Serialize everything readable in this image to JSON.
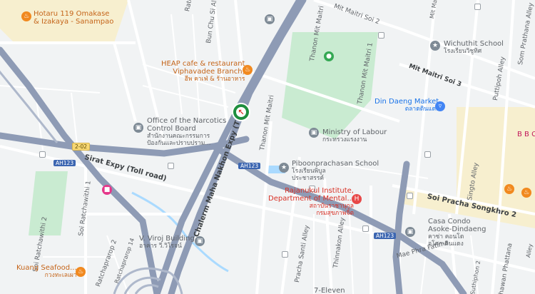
{
  "colors": {
    "background": "#f1f3f4",
    "road": "#ffffff",
    "expressway": "#8e9bb5",
    "park": "#c9ebd1",
    "water": "#aadaff",
    "highlight": "#f7efcf"
  },
  "roads": {
    "mit_maitri_soi_2": "Mit Maitri Soi 2",
    "mit_maitri_soi_3": "Mit Maitri Soi 3",
    "ratchawithi_1": "Ratchawithi",
    "bun_chu_si": "Bun Chu Si Alley",
    "thanon_mit_maitri_a": "Thanon Mit Maitri",
    "thanon_mit_maitri_b": "Thanon Mit Maitri",
    "thanon_mit_maitri_c": "Thanon Mit Maitri",
    "sirat_expy": "Sirat Expy (Toll road)",
    "chalerm_expy": "Chalerm Maha Nakhon Expy (T",
    "soi_ratchawithi_1": "Soi Ratchawithi 1",
    "soi_pracha_songkhro_2": "Soi Pracha Songkhro 2",
    "pracha_santi": "Pracha Santi Alley",
    "thinnakon": "Thinnakon Alley",
    "singto": "Singto Alley",
    "puttipoh": "Puttipoh Alley",
    "som_prathana": "Som Prathana Alley",
    "ratchaprarop_2": "Ratchaprarop 2",
    "ratchaprarop_14": "Ratchaprarop 14",
    "suthiphon_2": "Suthiphon 2",
    "mae_phra_fatima": "Mae Phra Fatima",
    "thawan_phattana": "hawan Phattana",
    "mit_maitri_soi_1": "Mit Maitri Soi 1",
    "alley_right": "Alley",
    "soi_ratchawithi_2": "Soi Ratchawithi 2",
    "thanon_mit_maitri_1": "Thanon Mit Maitri 1"
  },
  "shields": {
    "ah123_a": "AH123",
    "ah123_b": "AH123",
    "ah123_c": "AH123",
    "route_2": "2-02"
  },
  "places": {
    "hotaru": {
      "name": "Hotaru 119 Omakase",
      "line2": "& Izakaya - Sanampao",
      "icon": "restaurant-icon"
    },
    "heap": {
      "name": "HEAP cafe & restaurant",
      "line2": "Viphavadee Branch)",
      "thai": "ฮีพ คาเฟ่ & ร้านอาหาร"
    },
    "narcotics": {
      "name": "Office of the Narcotics",
      "line2": "Control Board",
      "thai1": "สำนักงานคณะกรรมการ",
      "thai2": "ป้องกันและปราบปราม..."
    },
    "ministry": {
      "name": "Ministry of Labour",
      "thai": "กระทรวงแรงงาน"
    },
    "piboon": {
      "name": "Piboonprachasan School",
      "thai1": "โรงเรียนพิบูล",
      "thai2": "ประชาสรรค์"
    },
    "rajanukul": {
      "name": "Rajanukul Institute,",
      "line2": "Department of Mental...",
      "thai1": "สถาบันราชานุกูล",
      "thai2": "กรมสุขภาพจิต"
    },
    "wichuthit": {
      "name": "Wichuthit School",
      "thai": "โรงเรียนวิชูทิศ"
    },
    "din_daeng": {
      "name": "Din Daeng Market",
      "thai": "ตลาดดินแดง"
    },
    "casa": {
      "name": "Casa Condo",
      "line2": "Asoke-Dindaeng",
      "thai1": "คาซ่า คอนโด",
      "thai2": "อโศก-ดินแดง"
    },
    "kuang": {
      "name": "Kuang Seafood...",
      "thai": "กวงทะเลเผา"
    },
    "viroj": {
      "name": "V. Viroj Building",
      "thai": "อาคาร วี.วิโรจน์"
    },
    "seven": {
      "name": "7-Eleven"
    },
    "bbc": {
      "name": "B B C"
    }
  }
}
